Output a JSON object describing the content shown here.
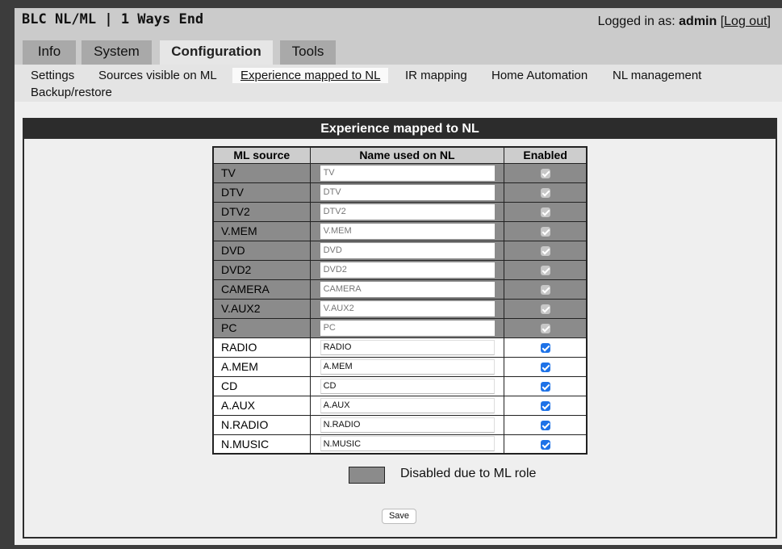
{
  "header": {
    "title": "BLC NL/ML | 1 Ways End",
    "logged_in_prefix": "Logged in as: ",
    "user": "admin",
    "logout_open": " [",
    "logout_label": "Log out",
    "logout_close": "]"
  },
  "tabs": [
    {
      "label": "Info"
    },
    {
      "label": "System"
    },
    {
      "label": "Configuration"
    },
    {
      "label": "Tools"
    }
  ],
  "subnav": [
    {
      "label": "Settings"
    },
    {
      "label": "Sources visible on ML"
    },
    {
      "label": "Experience mapped to NL"
    },
    {
      "label": "IR mapping"
    },
    {
      "label": "Home Automation"
    },
    {
      "label": "NL management"
    },
    {
      "label": "Backup/restore"
    }
  ],
  "panel": {
    "title": "Experience mapped to NL",
    "columns": [
      "ML source",
      "Name used on NL",
      "Enabled"
    ],
    "rows": [
      {
        "source": "TV",
        "name": "TV",
        "enabled": true,
        "disabled": true
      },
      {
        "source": "DTV",
        "name": "DTV",
        "enabled": true,
        "disabled": true
      },
      {
        "source": "DTV2",
        "name": "DTV2",
        "enabled": true,
        "disabled": true
      },
      {
        "source": "V.MEM",
        "name": "V.MEM",
        "enabled": true,
        "disabled": true
      },
      {
        "source": "DVD",
        "name": "DVD",
        "enabled": true,
        "disabled": true
      },
      {
        "source": "DVD2",
        "name": "DVD2",
        "enabled": true,
        "disabled": true
      },
      {
        "source": "CAMERA",
        "name": "CAMERA",
        "enabled": true,
        "disabled": true
      },
      {
        "source": "V.AUX2",
        "name": "V.AUX2",
        "enabled": true,
        "disabled": true
      },
      {
        "source": "PC",
        "name": "PC",
        "enabled": true,
        "disabled": true
      },
      {
        "source": "RADIO",
        "name": "RADIO",
        "enabled": true,
        "disabled": false
      },
      {
        "source": "A.MEM",
        "name": "A.MEM",
        "enabled": true,
        "disabled": false
      },
      {
        "source": "CD",
        "name": "CD",
        "enabled": true,
        "disabled": false
      },
      {
        "source": "A.AUX",
        "name": "A.AUX",
        "enabled": true,
        "disabled": false
      },
      {
        "source": "N.RADIO",
        "name": "N.RADIO",
        "enabled": true,
        "disabled": false
      },
      {
        "source": "N.MUSIC",
        "name": "N.MUSIC",
        "enabled": true,
        "disabled": false
      }
    ],
    "legend_text": "Disabled due to ML role",
    "save_label": "Save"
  }
}
